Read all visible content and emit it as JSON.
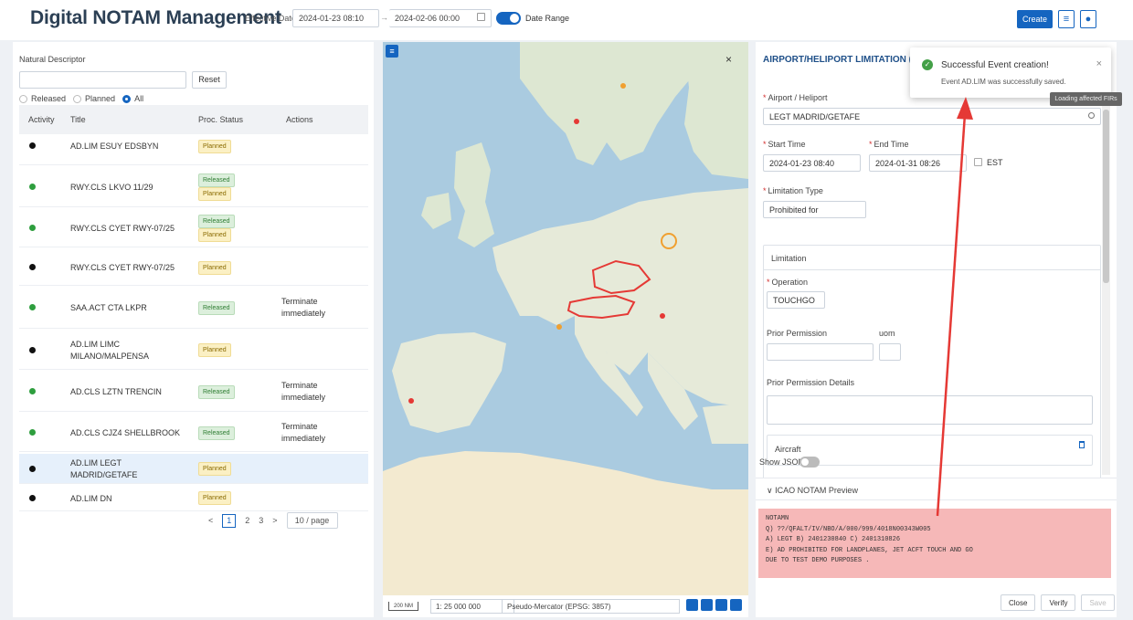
{
  "header": {
    "title": "Digital NOTAM Management",
    "effective_date_label": "Effective Date",
    "date_start": "2024-01-23 08:10",
    "date_separator": "→",
    "date_end": "2024-02-06 00:00",
    "date_range_label": "Date Range",
    "create_label": "Create"
  },
  "left": {
    "natural_descriptor_label": "Natural Descriptor",
    "search_value": "",
    "reset_label": "Reset",
    "filters": [
      "Released",
      "Planned",
      "All"
    ],
    "selected_filter": "All",
    "columns": [
      "Activity",
      "Title",
      "Proc. Status",
      "Actions"
    ],
    "rows": [
      {
        "title": "AD.LIM ESUY EDSBYN",
        "status": [
          "Planned"
        ],
        "action": ""
      },
      {
        "title": "RWY.CLS LKVO 11/29",
        "status": [
          "Released",
          "Planned"
        ],
        "action": ""
      },
      {
        "title": "RWY.CLS CYET RWY-07/25",
        "status": [
          "Released",
          "Planned"
        ],
        "action": ""
      },
      {
        "title": "RWY.CLS CYET RWY-07/25",
        "status": [
          "Planned"
        ],
        "action": ""
      },
      {
        "title": "SAA.ACT CTA LKPR",
        "status": [
          "Released"
        ],
        "action": "Terminate immediately"
      },
      {
        "title": "AD.LIM LIMC MILANO/MALPENSA",
        "status": [
          "Planned"
        ],
        "action": ""
      },
      {
        "title": "AD.CLS LZTN TRENCIN",
        "status": [
          "Released"
        ],
        "action": "Terminate immediately"
      },
      {
        "title": "AD.CLS CJZ4 SHELLBROOK",
        "status": [
          "Released"
        ],
        "action": "Terminate immediately"
      },
      {
        "title": "AD.LIM LEGT MADRID/GETAFE",
        "status": [
          "Planned"
        ],
        "action": ""
      },
      {
        "title": "AD.LIM DN",
        "status": [
          "Planned"
        ],
        "action": ""
      }
    ],
    "pagination": {
      "prev": "<",
      "pages": [
        "1",
        "2",
        "3"
      ],
      "current": "1",
      "next": ">",
      "page_size": "10 / page"
    }
  },
  "map": {
    "close": "×",
    "scale_label": "200 NM",
    "ratio": "1: 25 000 000",
    "projection": "Pseudo-Mercator (EPSG: 3857)"
  },
  "right": {
    "title": "AIRPORT/HELIPORT LIMITATION (AD.L",
    "airport_label": "Airport / Heliport",
    "airport_value": "LEGT MADRID/GETAFE",
    "start_time_label": "Start Time",
    "start_time_value": "2024-01-23 08:40",
    "end_time_label": "End Time",
    "end_time_value": "2024-01-31 08:26",
    "est_label": "EST",
    "limitation_type_label": "Limitation Type",
    "limitation_type_value": "Prohibited for",
    "limitation_section": "Limitation",
    "operation_label": "Operation",
    "operation_value": "TOUCHGO",
    "prior_permission_label": "Prior Permission",
    "uom_label": "uom",
    "prior_permission_details_label": "Prior Permission Details",
    "aircraft_label": "Aircraft",
    "show_json_label": "Show JSON",
    "icao_preview_label": "ICAO NOTAM Preview",
    "notam_lines": [
      "NOTAMN",
      "Q) ??/QFALT/IV/NBO/A/000/999/4018N00343W005",
      "A) LEGT B) 2401230840 C) 2401310826",
      "E) AD PROHIBITED FOR LANDPLANES, JET ACFT TOUCH AND GO",
      "DUE TO TEST DEMO PURPOSES ."
    ],
    "buttons": {
      "close": "Close",
      "verify": "Verify",
      "save": "Save"
    }
  },
  "toast": {
    "title": "Successful Event creation!",
    "message": "Event AD.LIM was successfully saved.",
    "close": "×"
  },
  "tooltip": "Loading affected FIRs",
  "colors": {
    "accent": "#1565c0",
    "title": "#2b3f54",
    "planned_bg": "#fbf0c4",
    "released_bg": "#dcefdc",
    "notam_bg": "#f6b8b8",
    "annotation_arrow": "#e53935",
    "highlight_region": "#e53935"
  }
}
